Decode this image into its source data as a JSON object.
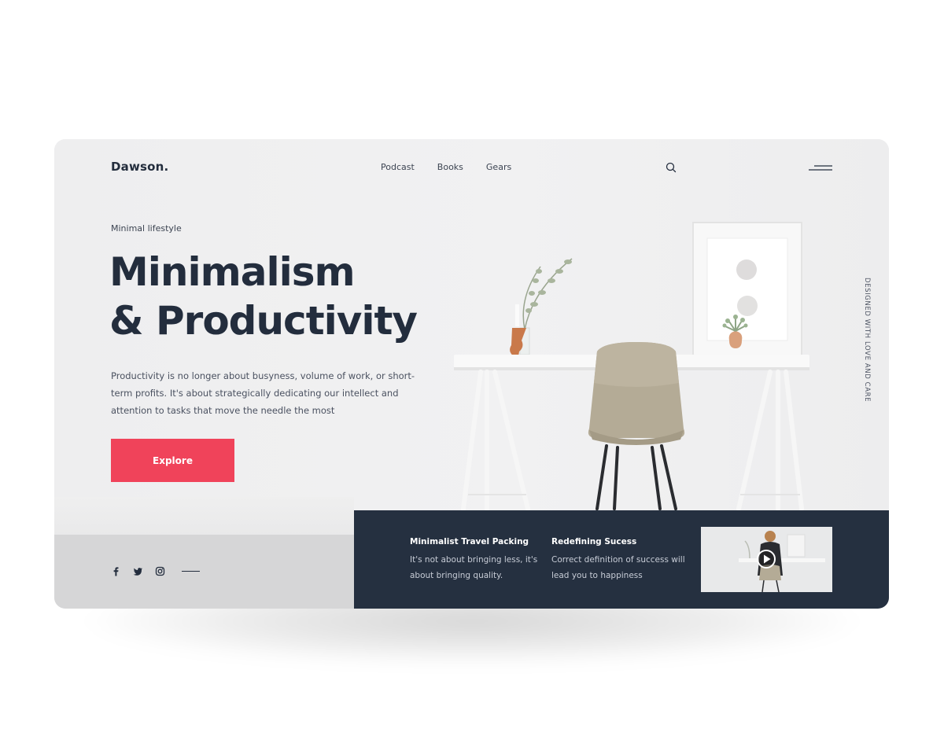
{
  "brand": {
    "logo": "Dawson."
  },
  "nav": {
    "items": [
      "Podcast",
      "Books",
      "Gears"
    ]
  },
  "header": {
    "search_icon": "search-icon",
    "menu_icon": "hamburger-menu-icon"
  },
  "hero": {
    "eyebrow": "Minimal lifestyle",
    "title_line1": "Minimalism",
    "title_line2": "& Productivity",
    "description": "Productivity is no longer about busyness, volume of work, or short-term profits. It's about strategically dedicating our intellect and attention to tasks that move the needle the most",
    "cta_label": "Explore"
  },
  "side_tagline": "DESIGNED WITH LOVE AND CARE",
  "social": {
    "icons": [
      "facebook-icon",
      "twitter-icon",
      "instagram-icon"
    ]
  },
  "articles": [
    {
      "title": "Minimalist Travel Packing",
      "text": "It's not about bringing less, it's about bringing quality."
    },
    {
      "title": "Redefining Sucess",
      "text": "Correct definition of success will lead you to happiness"
    }
  ],
  "video": {
    "icon": "play-icon"
  },
  "colors": {
    "accent": "#f0435a",
    "dark": "#253040",
    "text": "#232d3d",
    "background": "#efeff0"
  }
}
